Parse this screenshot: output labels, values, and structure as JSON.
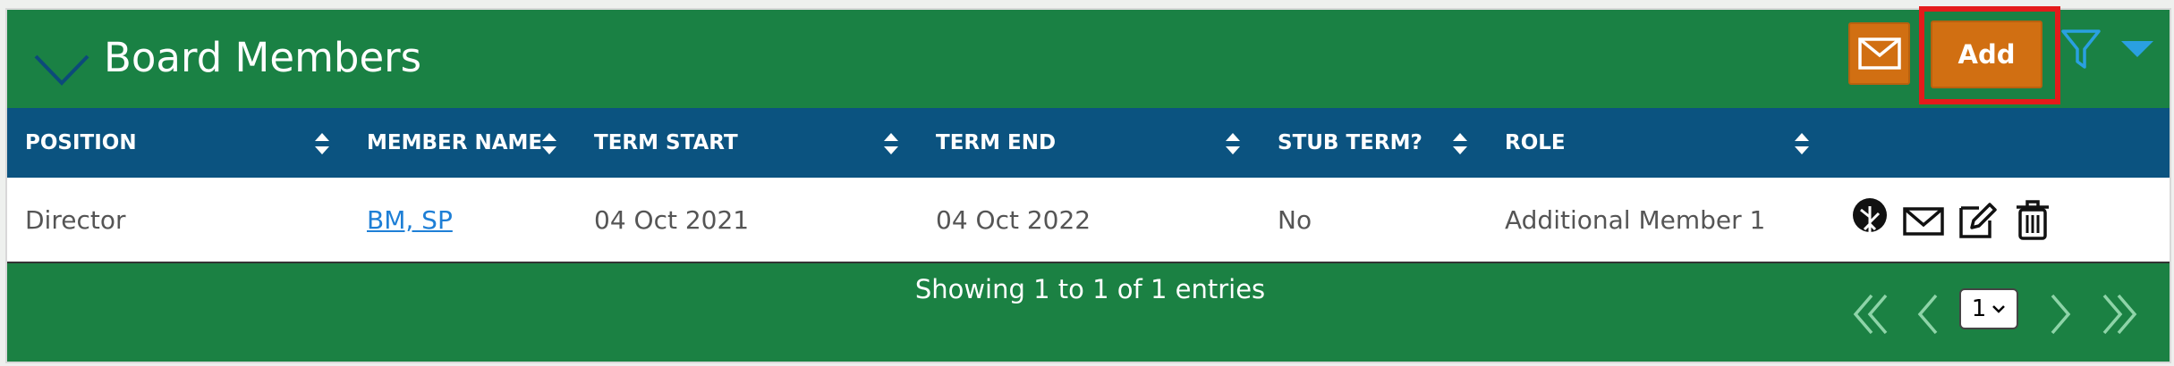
{
  "panel": {
    "title": "Board Members",
    "add_label": "Add"
  },
  "table": {
    "columns": [
      "POSITION",
      "MEMBER NAME",
      "TERM START",
      "TERM END",
      "STUB TERM?",
      "ROLE"
    ],
    "rows": [
      {
        "position": "Director",
        "member_name": "BM, SP",
        "term_start": "04 Oct 2021",
        "term_end": "04 Oct 2022",
        "stub_term": "No",
        "role": "Additional Member 1"
      }
    ]
  },
  "footer": {
    "info": "Showing 1 to 1 of 1 entries",
    "page_selected": "1"
  },
  "colors": {
    "header_green": "#1a8144",
    "table_header_blue": "#0b5380",
    "button_orange": "#d16f12",
    "highlight_red": "#e41b1b",
    "link_blue": "#1e7fd6"
  }
}
